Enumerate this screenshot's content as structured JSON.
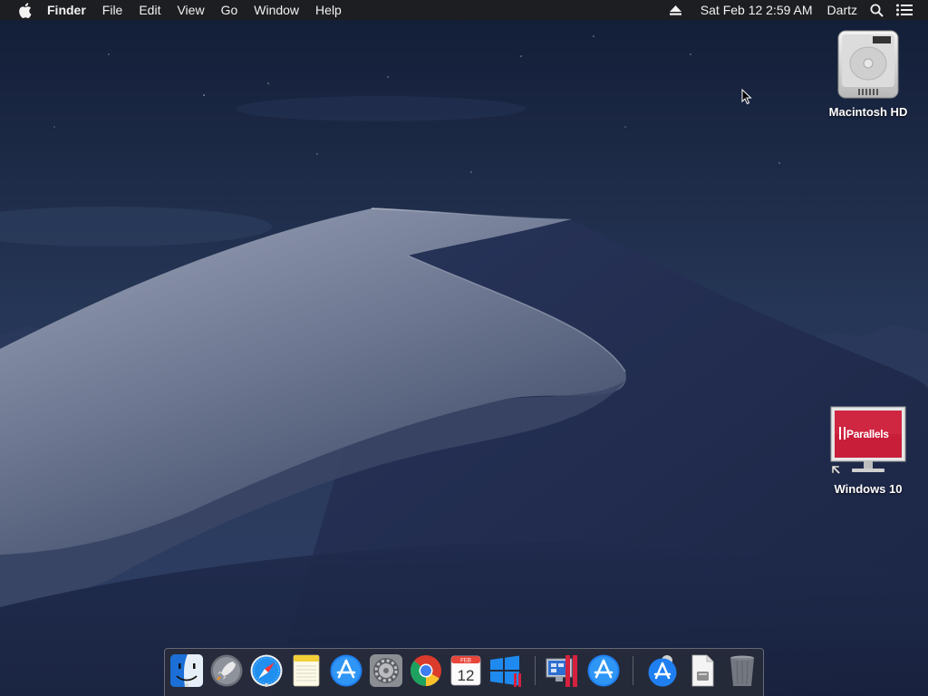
{
  "menubar": {
    "apple_icon": "apple-icon",
    "app_name": "Finder",
    "menus": [
      "File",
      "Edit",
      "View",
      "Go",
      "Window",
      "Help"
    ],
    "datetime": "Sat Feb 12  2:59 AM",
    "user": "Dartz",
    "status_icons": [
      "eject-icon",
      "spotlight-search-icon",
      "notification-center-icon"
    ]
  },
  "desktop": {
    "icons": [
      {
        "label": "Macintosh HD",
        "icon": "hard-drive-icon"
      },
      {
        "label": "Windows 10",
        "icon": "parallels-vm-icon",
        "badge": "Parallels"
      }
    ]
  },
  "dock": {
    "items": [
      {
        "name": "Finder",
        "icon": "finder-icon",
        "running": true
      },
      {
        "name": "Launchpad",
        "icon": "launchpad-icon",
        "running": false
      },
      {
        "name": "Safari",
        "icon": "safari-icon",
        "running": true
      },
      {
        "name": "Notes",
        "icon": "notes-icon",
        "running": false
      },
      {
        "name": "App Store",
        "icon": "app-store-icon",
        "running": false
      },
      {
        "name": "System Preferences",
        "icon": "system-preferences-icon",
        "running": false
      },
      {
        "name": "Google Chrome",
        "icon": "chrome-icon",
        "running": false
      },
      {
        "name": "Calendar",
        "icon": "calendar-icon",
        "running": false,
        "month": "FEB",
        "day": "12"
      },
      {
        "name": "Windows 10",
        "icon": "windows-parallels-icon",
        "running": false
      },
      {
        "name": "Parallels Desktop",
        "icon": "parallels-desktop-icon",
        "running": false
      },
      {
        "name": "App Store",
        "icon": "app-store-icon",
        "running": false
      },
      {
        "name": "Downloads",
        "icon": "downloads-stack-icon",
        "running": false
      },
      {
        "name": "Document",
        "icon": "document-stack-icon",
        "running": false
      },
      {
        "name": "Trash",
        "icon": "trash-icon",
        "running": false
      }
    ]
  },
  "colors": {
    "menubar_bg": "#1e1e20",
    "sky_top": "#16233f",
    "sky_bottom": "#2a3a5c",
    "dune_light": "#8e97ad",
    "dune_dark": "#1f2a4a",
    "parallels_red": "#c81e3a"
  }
}
